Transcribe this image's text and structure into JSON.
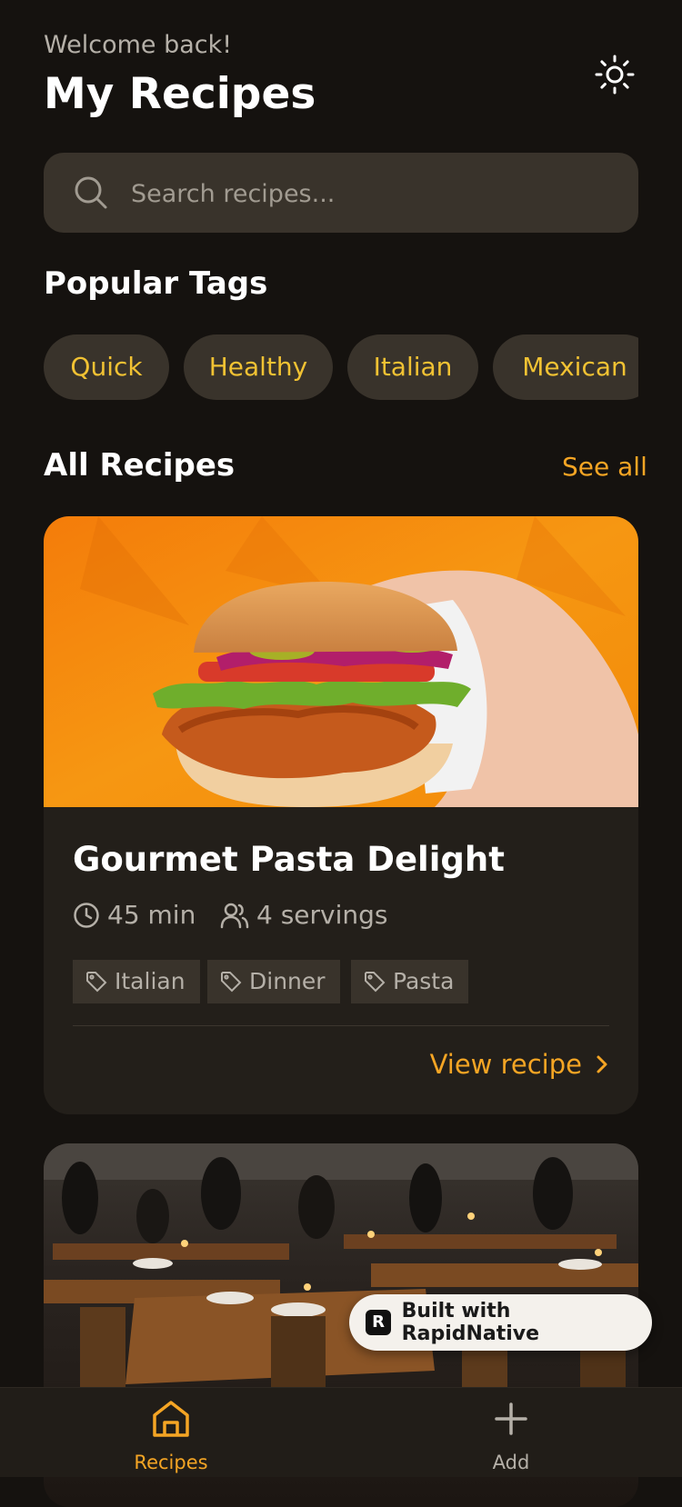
{
  "header": {
    "greeting": "Welcome back!",
    "title": "My Recipes",
    "theme_toggle_icon": "sun-icon"
  },
  "search": {
    "placeholder": "Search recipes...",
    "value": "",
    "icon": "search-icon"
  },
  "popular_tags": {
    "title": "Popular Tags",
    "items": [
      "Quick",
      "Healthy",
      "Italian",
      "Mexican"
    ]
  },
  "all_recipes": {
    "title": "All Recipes",
    "see_all_label": "See all"
  },
  "recipes": [
    {
      "image": "chicken-sandwich-photo",
      "title": "Gourmet Pasta Delight",
      "time": "45 min",
      "servings": "4 servings",
      "tags": [
        "Italian",
        "Dinner",
        "Pasta"
      ],
      "action_label": "View recipe"
    },
    {
      "image": "restaurant-interior-photo"
    }
  ],
  "badge": {
    "label": "Built with RapidNative"
  },
  "tabbar": {
    "items": [
      {
        "label": "Recipes",
        "icon": "home-icon",
        "active": true
      },
      {
        "label": "Add",
        "icon": "plus-icon",
        "active": false
      }
    ]
  },
  "colors": {
    "background": "#15120f",
    "surface": "#39332b",
    "card": "#231f1a",
    "accent": "#f5a524",
    "tag_text": "#f1c233",
    "muted_text": "#b5b0a8"
  }
}
